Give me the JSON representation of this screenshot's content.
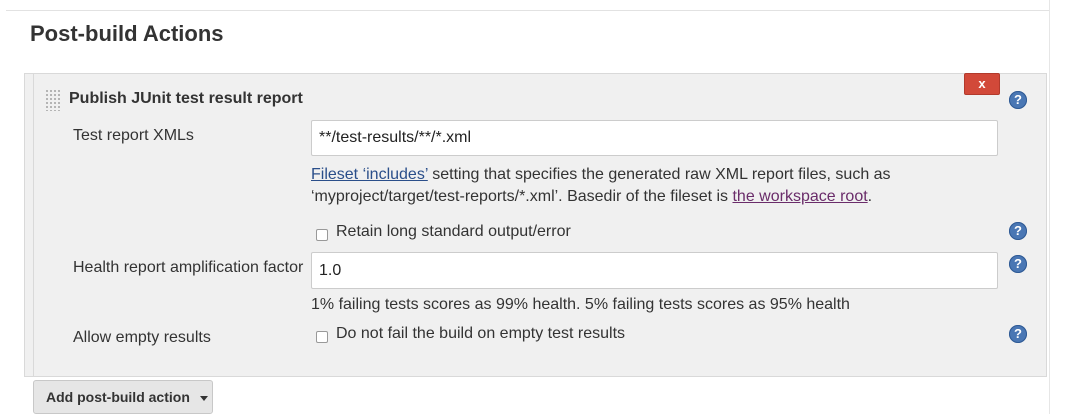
{
  "section": {
    "title": "Post-build Actions"
  },
  "panel": {
    "title": "Publish JUnit test result report",
    "delete_label": "x",
    "help_glyph": "?",
    "test_report": {
      "label": "Test report XMLs",
      "value": "**/test-results/**/*.xml",
      "desc_link1": "Fileset ‘includes’",
      "desc_text1": " setting that specifies the generated raw XML report files, such as",
      "desc_text2": "‘myproject/target/test-reports/*.xml’. Basedir of the fileset is ",
      "desc_link2": "the workspace root",
      "desc_text3": "."
    },
    "retain": {
      "label": "Retain long standard output/error",
      "checked": false
    },
    "health": {
      "label": "Health report amplification factor",
      "value": "1.0",
      "desc": "1% failing tests scores as 99% health. 5% failing tests scores as 95% health"
    },
    "allow_empty": {
      "label": "Allow empty results",
      "checkbox_label": "Do not fail the build on empty test results",
      "checked": false
    }
  },
  "add_action": {
    "label": "Add post-build action",
    "icon": "caret-down-icon"
  },
  "colors": {
    "delete": "#d24939",
    "help": "#4a77b4",
    "link": "#2a4e8a",
    "visited_link": "#6a2c6a"
  }
}
